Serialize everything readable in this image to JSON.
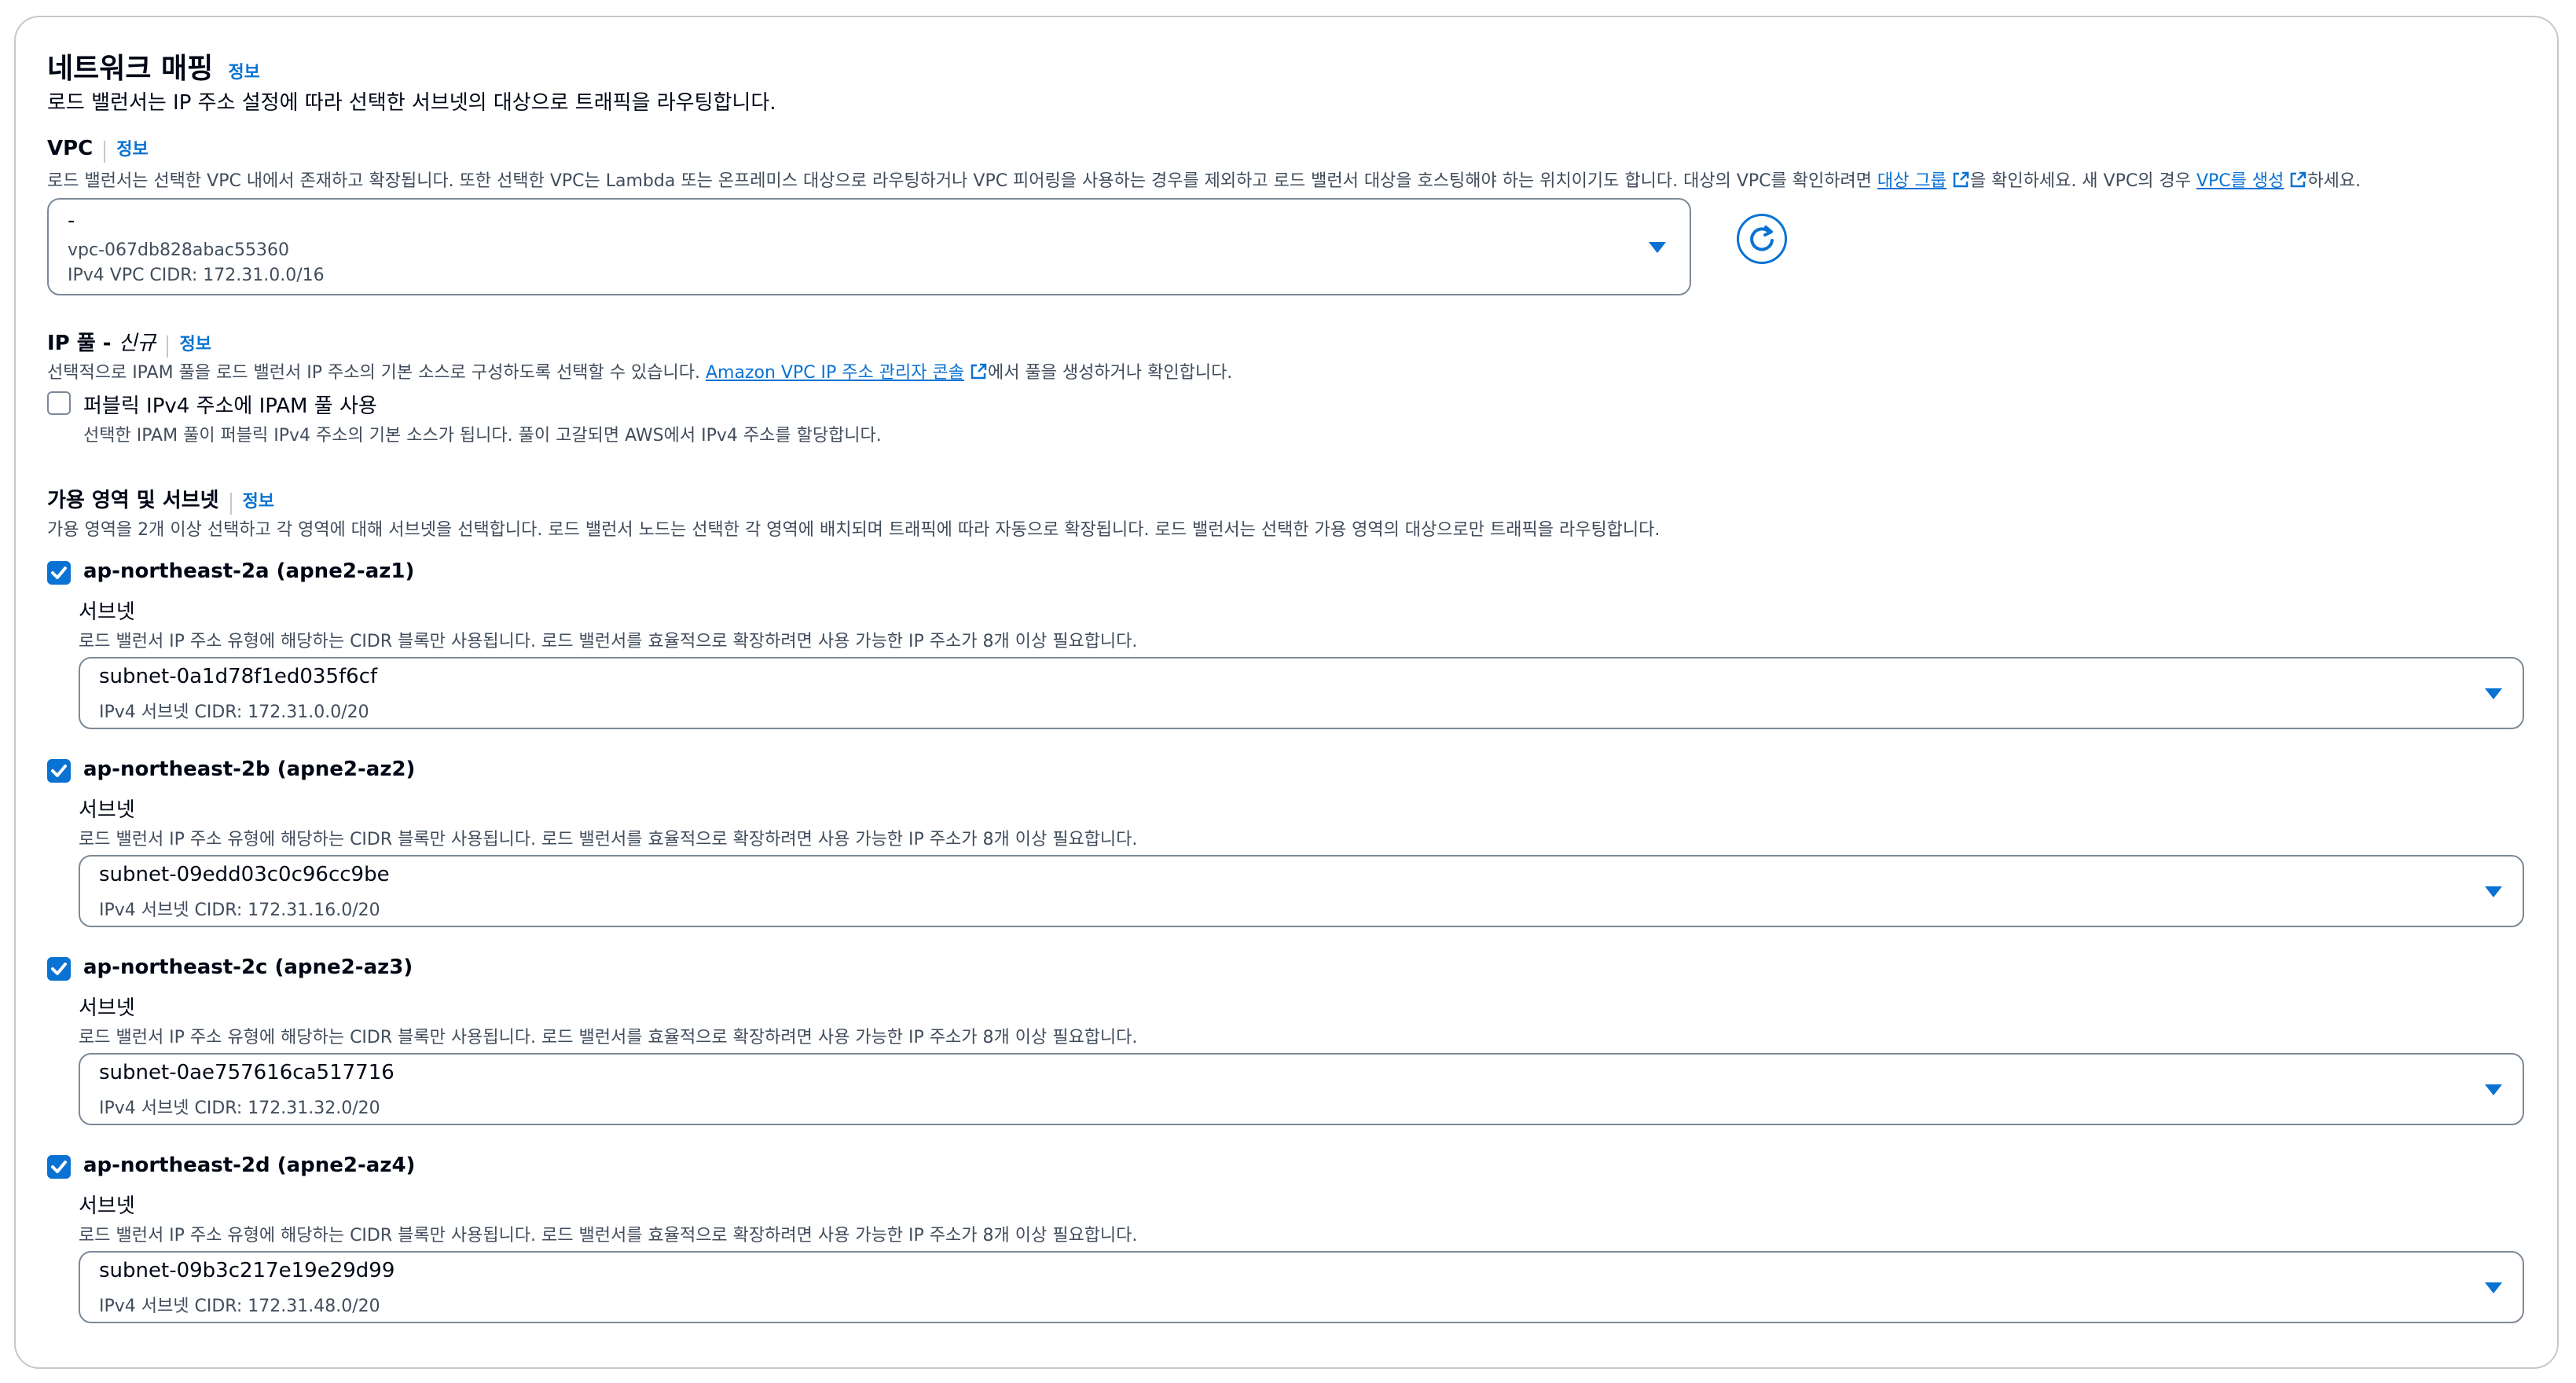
{
  "section": {
    "title": "네트워크 매핑",
    "info": "정보",
    "description": "로드 밸런서는 IP 주소 설정에 따라 선택한 서브넷의 대상으로 트래픽을 라우팅합니다."
  },
  "vpc": {
    "label": "VPC",
    "info": "정보",
    "description_part1": "로드 밸런서는 선택한 VPC 내에서 존재하고 확장됩니다. 또한 선택한 VPC는 Lambda 또는 온프레미스 대상으로 라우팅하거나 VPC 피어링을 사용하는 경우를 제외하고 로드 밸런서 대상을 호스팅해야 하는 위치이기도 합니다. 대상의 VPC를 확인하려면 ",
    "link_target_group": "대상 그룹",
    "description_part2": "을 확인하세요. 새 VPC의 경우 ",
    "link_create_vpc": "VPC를 생성",
    "description_part3": "하세요.",
    "selected_name": "-",
    "selected_id": "vpc-067db828abac55360",
    "selected_cidr": "IPv4 VPC CIDR: 172.31.0.0/16"
  },
  "ip_pool": {
    "label": "IP 풀 - ",
    "label_new": "신규",
    "info": "정보",
    "description_part1": "선택적으로 IPAM 풀을 로드 밸런서 IP 주소의 기본 소스로 구성하도록 선택할 수 있습니다. ",
    "link_ipam": "Amazon VPC IP 주소 관리자 콘솔",
    "description_part2": "에서 풀을 생성하거나 확인합니다.",
    "checkbox_label": "퍼블릭 IPv4 주소에 IPAM 풀 사용",
    "checkbox_checked": false,
    "checkbox_help": "선택한 IPAM 풀이 퍼블릭 IPv4 주소의 기본 소스가 됩니다. 풀이 고갈되면 AWS에서 IPv4 주소를 할당합니다."
  },
  "az": {
    "label": "가용 영역 및 서브넷",
    "info": "정보",
    "description": "가용 영역을 2개 이상 선택하고 각 영역에 대해 서브넷을 선택합니다. 로드 밸런서 노드는 선택한 각 영역에 배치되며 트래픽에 따라 자동으로 확장됩니다. 로드 밸런서는 선택한 가용 영역의 대상으로만 트래픽을 라우팅합니다.",
    "zones": [
      {
        "name": "ap-northeast-2a (apne2-az1)",
        "checked": true,
        "subnet_label": "서브넷",
        "subnet_help": "로드 밸런서 IP 주소 유형에 해당하는 CIDR 블록만 사용됩니다. 로드 밸런서를 효율적으로 확장하려면 사용 가능한 IP 주소가 8개 이상 필요합니다.",
        "subnet_id": "subnet-0a1d78f1ed035f6cf",
        "subnet_cidr": "IPv4 서브넷 CIDR: 172.31.0.0/20"
      },
      {
        "name": "ap-northeast-2b (apne2-az2)",
        "checked": true,
        "subnet_label": "서브넷",
        "subnet_help": "로드 밸런서 IP 주소 유형에 해당하는 CIDR 블록만 사용됩니다. 로드 밸런서를 효율적으로 확장하려면 사용 가능한 IP 주소가 8개 이상 필요합니다.",
        "subnet_id": "subnet-09edd03c0c96cc9be",
        "subnet_cidr": "IPv4 서브넷 CIDR: 172.31.16.0/20"
      },
      {
        "name": "ap-northeast-2c (apne2-az3)",
        "checked": true,
        "subnet_label": "서브넷",
        "subnet_help": "로드 밸런서 IP 주소 유형에 해당하는 CIDR 블록만 사용됩니다. 로드 밸런서를 효율적으로 확장하려면 사용 가능한 IP 주소가 8개 이상 필요합니다.",
        "subnet_id": "subnet-0ae757616ca517716",
        "subnet_cidr": "IPv4 서브넷 CIDR: 172.31.32.0/20"
      },
      {
        "name": "ap-northeast-2d (apne2-az4)",
        "checked": true,
        "subnet_label": "서브넷",
        "subnet_help": "로드 밸런서 IP 주소 유형에 해당하는 CIDR 블록만 사용됩니다. 로드 밸런서를 효율적으로 확장하려면 사용 가능한 IP 주소가 8개 이상 필요합니다.",
        "subnet_id": "subnet-09b3c217e19e29d99",
        "subnet_cidr": "IPv4 서브넷 CIDR: 172.31.48.0/20"
      }
    ]
  },
  "colors": {
    "accent": "#0972d3",
    "border": "#7d8998",
    "text": "#000716",
    "muted": "#414d5c"
  },
  "icons": [
    "external-link-icon",
    "refresh-icon",
    "chevron-down-icon",
    "checkmark-icon"
  ]
}
